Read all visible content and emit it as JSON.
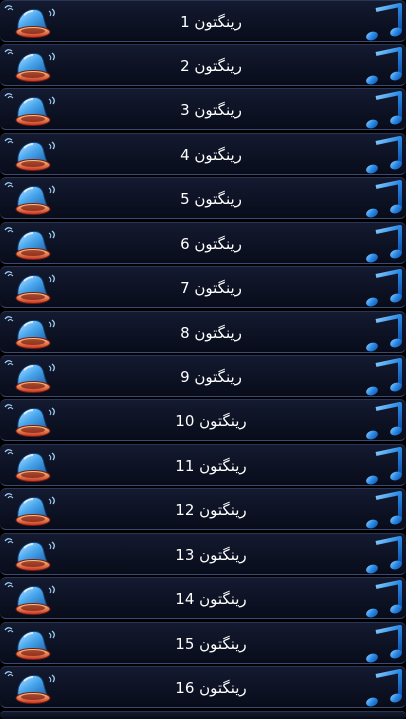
{
  "ringtone_list": {
    "items": [
      {
        "label": "رینگتون 1",
        "left_icon": "bell-icon",
        "right_icon": "music-note-icon"
      },
      {
        "label": "رینگتون 2",
        "left_icon": "bell-icon",
        "right_icon": "music-note-icon"
      },
      {
        "label": "رینگتون 3",
        "left_icon": "bell-icon",
        "right_icon": "music-note-icon"
      },
      {
        "label": "رینگتون 4",
        "left_icon": "bell-icon",
        "right_icon": "music-note-icon"
      },
      {
        "label": "رینگتون 5",
        "left_icon": "bell-icon",
        "right_icon": "music-note-icon"
      },
      {
        "label": "رینگتون 6",
        "left_icon": "bell-icon",
        "right_icon": "music-note-icon"
      },
      {
        "label": "رینگتون 7",
        "left_icon": "bell-icon",
        "right_icon": "music-note-icon"
      },
      {
        "label": "رینگتون 8",
        "left_icon": "bell-icon",
        "right_icon": "music-note-icon"
      },
      {
        "label": "رینگتون 9",
        "left_icon": "bell-icon",
        "right_icon": "music-note-icon"
      },
      {
        "label": "رینگتون 10",
        "left_icon": "bell-icon",
        "right_icon": "music-note-icon"
      },
      {
        "label": "رینگتون 11",
        "left_icon": "bell-icon",
        "right_icon": "music-note-icon"
      },
      {
        "label": "رینگتون 12",
        "left_icon": "bell-icon",
        "right_icon": "music-note-icon"
      },
      {
        "label": "رینگتون 13",
        "left_icon": "bell-icon",
        "right_icon": "music-note-icon"
      },
      {
        "label": "رینگتون 14",
        "left_icon": "bell-icon",
        "right_icon": "music-note-icon"
      },
      {
        "label": "رینگتون 15",
        "left_icon": "bell-icon",
        "right_icon": "music-note-icon"
      },
      {
        "label": "رینگتون 16",
        "left_icon": "bell-icon",
        "right_icon": "music-note-icon"
      }
    ]
  },
  "colors": {
    "row_background": "#0d1224",
    "row_border": "#3a4a70",
    "text": "#ffffff",
    "bell_blue": "#3fa0ea",
    "bell_mouth": "#d83a2a",
    "note_blue": "#1f7fe0"
  }
}
